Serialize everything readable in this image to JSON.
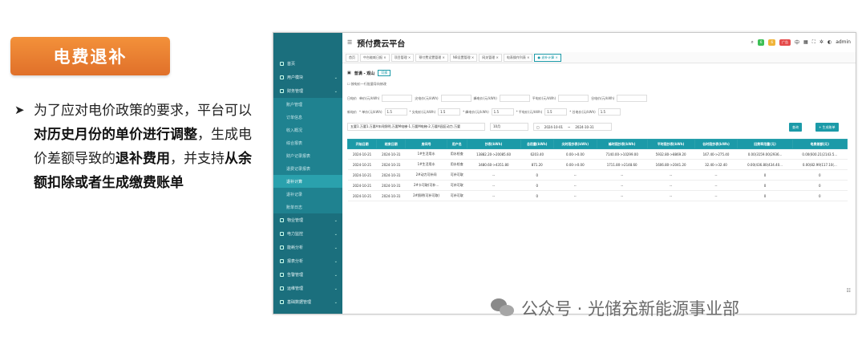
{
  "slide": {
    "title": "电费退补",
    "bullet_parts": [
      {
        "text": "为了应对电价政策的要求，平台可以",
        "bold": false
      },
      {
        "text": "对历史月份的单价进行调整",
        "bold": true
      },
      {
        "text": "，生成电价差额导致的",
        "bold": false
      },
      {
        "text": "退补费用",
        "bold": true
      },
      {
        "text": "，并支持",
        "bold": false
      },
      {
        "text": "从余额扣除或者生成缴费账单",
        "bold": true
      }
    ],
    "watermark": "公众号 · 光储充新能源事业部"
  },
  "app": {
    "brand": "预付费云平台",
    "user": "admin",
    "pills": [
      "6",
      "6",
      "广告"
    ],
    "tabs": [
      "首页",
      "中台能耗日报 ×",
      "项目管理 ×",
      "预付费设置管理 ×",
      "NB设置管理 ×",
      "网关管理 ×",
      "电表操作列表 ×",
      "● 退补计算 ×"
    ],
    "sidebar": [
      {
        "label": "首页",
        "type": "item"
      },
      {
        "label": "用户模块",
        "type": "item"
      },
      {
        "label": "财务管理",
        "type": "item"
      },
      {
        "label": "账户管理",
        "type": "sub"
      },
      {
        "label": "订单信息",
        "type": "sub"
      },
      {
        "label": "收入概况",
        "type": "sub"
      },
      {
        "label": "综合报表",
        "type": "sub"
      },
      {
        "label": "财户记录报表",
        "type": "sub"
      },
      {
        "label": "退费记录报表",
        "type": "sub"
      },
      {
        "label": "退补计算",
        "type": "sub",
        "active": true
      },
      {
        "label": "退补记录",
        "type": "sub"
      },
      {
        "label": "账单日志",
        "type": "sub"
      },
      {
        "label": "物业管理",
        "type": "item"
      },
      {
        "label": "电力监控",
        "type": "item"
      },
      {
        "label": "能耗分析",
        "type": "item"
      },
      {
        "label": "报表分析",
        "type": "item"
      },
      {
        "label": "告警管理",
        "type": "item"
      },
      {
        "label": "运维管理",
        "type": "item"
      },
      {
        "label": "基础数据管理",
        "type": "item"
      }
    ],
    "crumb": "普满 - 观山",
    "crumb_switch": "切换",
    "checkbox_label": "按电价一行批量导向修改",
    "row1": [
      {
        "label": "日电价",
        "field": "单价(元/kWh)",
        "value": ""
      },
      {
        "label": "",
        "field": "尖电价(元/kWh)",
        "value": ""
      },
      {
        "label": "",
        "field": "峰电价(元/kWh)",
        "value": ""
      },
      {
        "label": "",
        "field": "平电价(元/kWh)",
        "value": ""
      },
      {
        "label": "",
        "field": "谷电价(元/kWh)",
        "value": ""
      }
    ],
    "row2": [
      {
        "label": "新电价",
        "field": "* 单价(元/kWh)",
        "value": "1.5"
      },
      {
        "label": "",
        "field": "* 尖电价(元/kWh)",
        "value": "1.5"
      },
      {
        "label": "",
        "field": "* 峰电价(元/kWh)",
        "value": "1.5"
      },
      {
        "label": "",
        "field": "* 平电价(元/kWh)",
        "value": "1.5"
      },
      {
        "label": "",
        "field": "* 谷电价(元/kWh)",
        "value": "1.5"
      }
    ],
    "select_meters": "五要1.万要1.万要A车间照明,万要M电梯-1.万要M电梯-2.万要A园区动力.万要",
    "select_month": "10月",
    "date_from": "2024-10-01",
    "date_to": "2024-10-31",
    "btn_query": "查询",
    "btn_generate": "+ 生成账单",
    "columns": [
      "开始日期",
      "结束日期",
      "房间号",
      "用户名",
      "抄表(kWh)",
      "总用量(kWh)",
      "尖时段抄表(kWh)",
      "峰时段抄表(kWh)",
      "平时段抄表(kWh)",
      "谷时段抄表(kWh)",
      "旧费率用量(元)",
      "电费差额(元)"
    ],
    "rows": [
      [
        "2024-10-21",
        "2024-10-31",
        "1#生活用水",
        "用水检查",
        "13882.20->20085.60",
        "6203.40",
        "0.00->0.00",
        "7140.00->10299.00",
        "5932.80->8869.20",
        "167.40->275.40",
        "0.00(3159.00(2936...",
        "0.00(600.21(2143.5..."
      ],
      [
        "2024-10-21",
        "2024-10-31",
        "1#生活用水",
        "用水检查",
        "3480.60->4351.80",
        "871.20",
        "0.00->0.00",
        "1711.80->2148.60",
        "1606.80->2041.20",
        "32.40->32.40",
        "0.00(436.80(434.40...",
        "0.00(82.99(117.10(..."
      ],
      [
        "2024-10-21",
        "2024-10-31",
        "2#动力可补间",
        "可补可取",
        "--",
        "0",
        "--",
        "--",
        "--",
        "--",
        "0",
        "0"
      ],
      [
        "2024-10-21",
        "2024-10-31",
        "2#卡可取(可补...",
        "可补可取",
        "--",
        "0",
        "--",
        "--",
        "--",
        "--",
        "0",
        "0"
      ],
      [
        "2024-10-21",
        "2024-10-31",
        "2#照明(可补可取)",
        "可补可取",
        "--",
        "0",
        "--",
        "--",
        "--",
        "--",
        "0",
        "0"
      ]
    ]
  }
}
